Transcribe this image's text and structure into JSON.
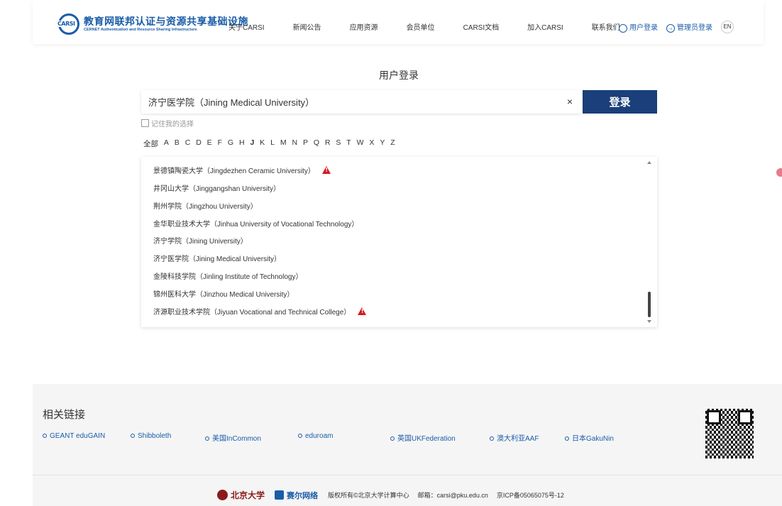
{
  "header": {
    "logo_badge": "CARSI",
    "logo_cn": "教育网联邦认证与资源共享基础设施",
    "logo_en": "CERNET Authentication and Resource Sharing Infrastructure",
    "nav": [
      "关于CARSI",
      "新闻公告",
      "应用资源",
      "会员单位",
      "CARSI文档",
      "加入CARSI",
      "联系我们"
    ],
    "user_login": "用户登录",
    "admin_login": "管理员登录",
    "lang": "EN"
  },
  "main": {
    "title": "用户登录",
    "search_value": "济宁医学院（Jining Medical University）",
    "clear_symbol": "×",
    "login_button": "登录",
    "remember_label": "记住我的选择",
    "alphabet": [
      "全部",
      "A",
      "B",
      "C",
      "D",
      "E",
      "F",
      "G",
      "H",
      "J",
      "K",
      "L",
      "M",
      "N",
      "P",
      "Q",
      "R",
      "S",
      "T",
      "W",
      "X",
      "Y",
      "Z"
    ],
    "list": [
      {
        "label": "景德镇陶瓷大学（Jingdezhen Ceramic University）",
        "warning": true
      },
      {
        "label": "井冈山大学（Jinggangshan University）",
        "warning": false
      },
      {
        "label": "荆州学院（Jingzhou University）",
        "warning": false
      },
      {
        "label": "金华职业技术大学（Jinhua University of Vocational Technology）",
        "warning": false
      },
      {
        "label": "济宁学院（Jining University）",
        "warning": false
      },
      {
        "label": "济宁医学院（Jining Medical University）",
        "warning": false
      },
      {
        "label": "金陵科技学院（Jinling Institute of Technology）",
        "warning": false
      },
      {
        "label": "锦州医科大学（Jinzhou Medical University）",
        "warning": false
      },
      {
        "label": "济源职业技术学院（Jiyuan Vocational and Technical College）",
        "warning": true
      }
    ]
  },
  "footer": {
    "title": "相关链接",
    "links": [
      "GEANT eduGAIN",
      "Shibboleth",
      "美国InCommon",
      "eduroam",
      "英国UKFederation",
      "澳大利亚AAF",
      "日本GakuNin"
    ],
    "pku": "北京大学",
    "cernet": "赛尔网络",
    "copyright": "版权所有©北京大学计算中心",
    "email": "邮箱：carsi@pku.edu.cn",
    "icp": "京ICP备05065075号-12"
  },
  "colors": {
    "accent": "#1a5ca8",
    "button": "#1a3f7a",
    "warning": "#d7181f"
  }
}
